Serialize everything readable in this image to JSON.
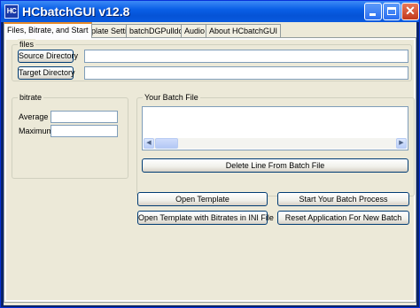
{
  "window": {
    "title": "HCbatchGUI v12.8",
    "app_icon_text": "HC"
  },
  "tabs": [
    {
      "label": "Files, Bitrate, and Start",
      "active": true
    },
    {
      "label": "Template Settings",
      "active": false
    },
    {
      "label": "batchDGPulldown",
      "active": false
    },
    {
      "label": "Audio",
      "active": false
    },
    {
      "label": "About HCbatchGUI",
      "active": false
    }
  ],
  "files_group": {
    "title": "files",
    "source_button": "Source Directory",
    "source_value": "",
    "target_button": "Target Directory",
    "target_value": ""
  },
  "bitrate_group": {
    "title": "bitrate",
    "average_label": "Average",
    "average_value": "",
    "maximum_label": "Maximum",
    "maximum_value": ""
  },
  "batch_group": {
    "title": "Your Batch File",
    "items": []
  },
  "buttons": {
    "delete_line": "Delete Line From Batch File",
    "open_template": "Open Template",
    "open_template_bitrates": "Open Template with Bitrates in INI File",
    "start_batch": "Start Your Batch Process",
    "reset_app": "Reset Application For New Batch"
  },
  "colors": {
    "titlebar": "#0553d6",
    "face": "#ece9d8",
    "active_tab_highlight": "#e68b2c"
  }
}
